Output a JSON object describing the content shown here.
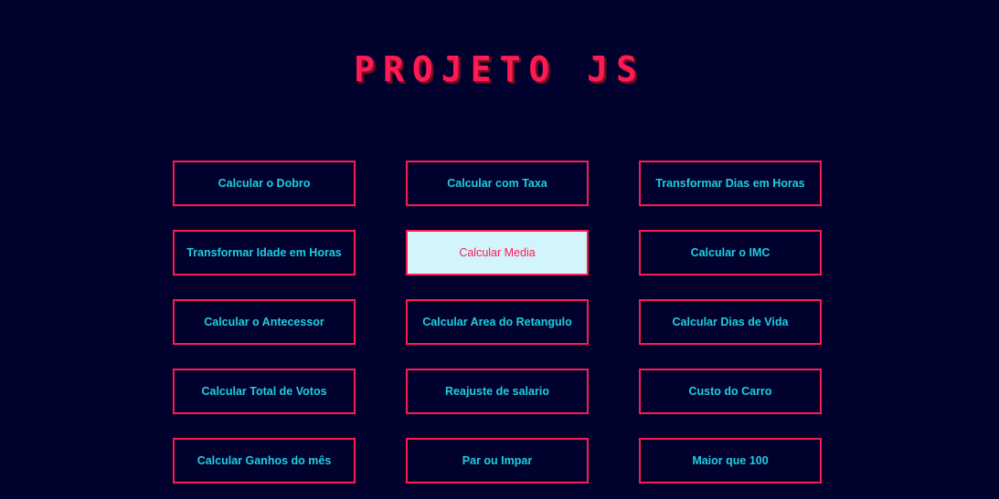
{
  "header": {
    "title": "PROJETO JS"
  },
  "colors": {
    "background": "#01012d",
    "accent": "#ff1a52",
    "button_text": "#1ccfe0",
    "active_button_bg": "#d2f5fb"
  },
  "buttons": [
    {
      "label": "Calcular o Dobro",
      "active": false
    },
    {
      "label": "Calcular com Taxa",
      "active": false
    },
    {
      "label": "Transformar Dias em Horas",
      "active": false
    },
    {
      "label": "Transformar Idade em Horas",
      "active": false
    },
    {
      "label": "Calcular Media",
      "active": true
    },
    {
      "label": "Calcular o IMC",
      "active": false
    },
    {
      "label": "Calcular o Antecessor",
      "active": false
    },
    {
      "label": "Calcular Area do Retangulo",
      "active": false
    },
    {
      "label": "Calcular Dias de Vida",
      "active": false
    },
    {
      "label": "Calcular Total de Votos",
      "active": false
    },
    {
      "label": "Reajuste de salario",
      "active": false
    },
    {
      "label": "Custo do Carro",
      "active": false
    },
    {
      "label": "Calcular Ganhos do mês",
      "active": false
    },
    {
      "label": "Par ou Impar",
      "active": false
    },
    {
      "label": "Maior que 100",
      "active": false
    }
  ]
}
